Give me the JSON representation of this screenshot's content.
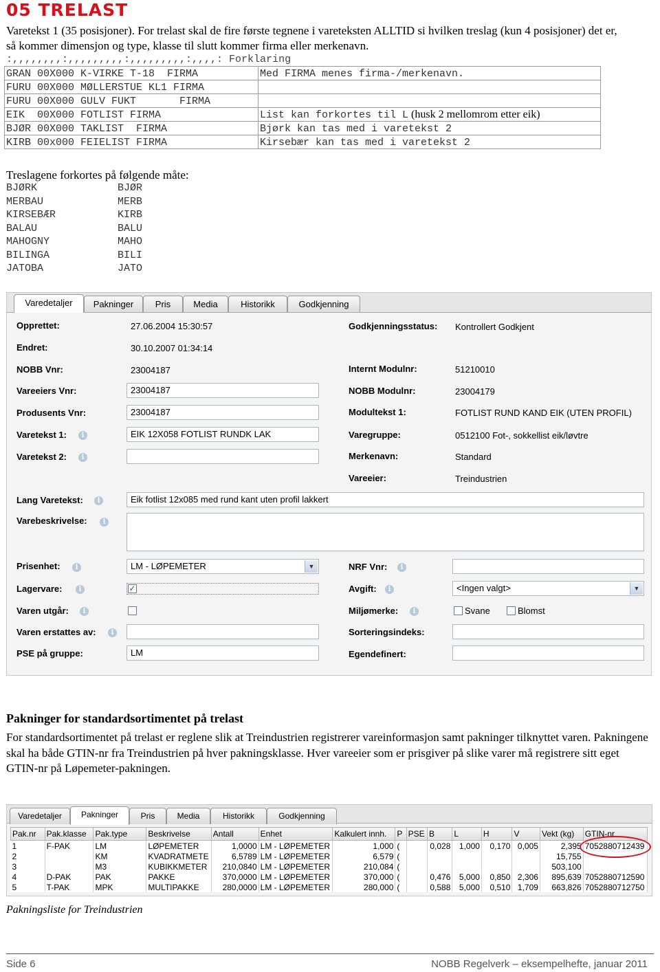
{
  "heading": "05 TRELAST",
  "intro": "Varetekst 1 (35 posisjoner). For trelast skal de fire første tegnene i vareteksten ALLTID si hvilken treslag (kun 4 posisjoner) det er, så kommer dimensjon og type, klasse til slutt kommer firma eller merkenavn.",
  "ruler": ":,,,,,,,,:,,,,,,,,,:,,,,,,,,,:,,,,: Forklaring",
  "code_rows": [
    {
      "code": "GRAN 00X000 K-VIRKE T-18  FIRMA",
      "note": "Med FIRMA menes firma-/merkenavn.",
      "note_extra": ""
    },
    {
      "code": "FURU 00X000 MØLLERSTUE KL1 FIRMA",
      "note": "",
      "note_extra": ""
    },
    {
      "code": "FURU 00X000 GULV FUKT       FIRMA",
      "note": "",
      "note_extra": ""
    },
    {
      "code": "EIK  00X000 FOTLIST FIRMA",
      "note": "List kan forkortes til L",
      "note_extra": " (husk 2 mellomrom etter eik)"
    },
    {
      "code": "BJØR 00X000 TAKLIST  FIRMA",
      "note": "Bjørk kan tas med i varetekst 2",
      "note_extra": ""
    },
    {
      "code": "KIRB 00x000 FEIELIST FIRMA",
      "note": "Kirsebær kan tas med i varetekst 2",
      "note_extra": ""
    }
  ],
  "species_heading": "Treslagene forkortes på følgende måte:",
  "species": [
    {
      "name": "BJØRK",
      "abbr": "BJØR"
    },
    {
      "name": "MERBAU",
      "abbr": "MERB"
    },
    {
      "name": "KIRSEBÆR",
      "abbr": "KIRB"
    },
    {
      "name": "BALAU",
      "abbr": "BALU"
    },
    {
      "name": "MAHOGNY",
      "abbr": "MAHO"
    },
    {
      "name": "BILINGA",
      "abbr": "BILI"
    },
    {
      "name": "JATOBA",
      "abbr": "JATO"
    }
  ],
  "panel1": {
    "tabs": [
      "Varedetaljer",
      "Pakninger",
      "Pris",
      "Media",
      "Historikk",
      "Godkjenning"
    ],
    "left": {
      "opprettet_label": "Opprettet:",
      "opprettet": "27.06.2004 15:30:57",
      "endret_label": "Endret:",
      "endret": "30.10.2007 01:34:14",
      "nobb_label": "NOBB Vnr:",
      "nobb": "23004187",
      "vareeier_label": "Vareeiers Vnr:",
      "vareeier": "23004187",
      "produsent_label": "Produsents Vnr:",
      "produsent": "23004187",
      "vt1_label": "Varetekst 1:",
      "vt1": "EIK  12X058 FOTLIST RUNDK LAK",
      "vt2_label": "Varetekst 2:",
      "vt2": "",
      "lang_label": "Lang Varetekst:",
      "lang": "Eik fotlist 12x085 med rund kant uten profil lakkert",
      "beskr_label": "Varebeskrivelse:",
      "beskr": "",
      "prisenhet_label": "Prisenhet:",
      "prisenhet": "LM - LØPEMETER",
      "lagervare_label": "Lagervare:",
      "utgar_label": "Varen utgår:",
      "erstattes_label": "Varen erstattes av:",
      "erstattes": "",
      "pse_label": "PSE på gruppe:",
      "pse": "LM"
    },
    "right": {
      "godkj_label": "Godkjenningsstatus:",
      "godkj": "Kontrollert Godkjent",
      "intern_label": "Internt Modulnr:",
      "intern": "51210010",
      "nobbmod_label": "NOBB Modulnr:",
      "nobbmod": "23004179",
      "modtekst_label": "Modultekst 1:",
      "modtekst": "FOTLIST RUND KAND EIK (UTEN PROFIL)",
      "varegr_label": "Varegruppe:",
      "varegr": "0512100 Fot-, sokkellist eik/løvtre",
      "merke_label": "Merkenavn:",
      "merke": "Standard",
      "vareeier_label": "Vareeier:",
      "vareeier": "Treindustrien",
      "nrf_label": "NRF Vnr:",
      "nrf": "",
      "avgift_label": "Avgift:",
      "avgift": "<Ingen valgt>",
      "miljo_label": "Miljømerke:",
      "svane": "Svane",
      "blomst": "Blomst",
      "sort_label": "Sorteringsindeks:",
      "sort": "",
      "egen_label": "Egendefinert:",
      "egen": ""
    }
  },
  "pak_heading": "Pakninger for standardsortimentet på trelast",
  "pak_text": "For standardsortimentet på trelast er reglene slik at Treindustrien registrerer vareinformasjon samt pakninger tilknyttet varen. Pakningene skal ha både GTIN-nr fra Treindustrien på hver pakningsklasse. Hver vareeier som er prisgiver på slike varer må registrere sitt eget GTIN-nr på Løpemeter-pakningen.",
  "panel2": {
    "tabs": [
      "Varedetaljer",
      "Pakninger",
      "Pris",
      "Media",
      "Historikk",
      "Godkjenning"
    ],
    "columns": [
      "Pak.nr",
      "Pak.klasse",
      "Pak.type",
      "Beskrivelse",
      "Antall",
      "Enhet",
      "Kalkulert innh.",
      "P",
      "PSE",
      "B",
      "L",
      "H",
      "V",
      "Vekt (kg)",
      "GTIN-nr"
    ],
    "rows": [
      [
        "1",
        "F-PAK",
        "LM",
        "LØPEMETER",
        "1,0000",
        "LM - LØPEMETER",
        "1,000",
        "(",
        "",
        "0,028",
        "1,000",
        "0,170",
        "0,005",
        "2,395",
        "7052880712439"
      ],
      [
        "2",
        "",
        "KM",
        "KVADRATMETE",
        "6,5789",
        "LM - LØPEMETER",
        "6,579",
        "(",
        "",
        "",
        "",
        "",
        "",
        "15,755",
        ""
      ],
      [
        "3",
        "",
        "M3",
        "KUBIKKMETER",
        "210,0840",
        "LM - LØPEMETER",
        "210,084",
        "(",
        "",
        "",
        "",
        "",
        "",
        "503,100",
        ""
      ],
      [
        "4",
        "D-PAK",
        "PAK",
        "PAKKE",
        "370,0000",
        "LM - LØPEMETER",
        "370,000",
        "(",
        "",
        "0,476",
        "5,000",
        "0,850",
        "2,306",
        "895,639",
        "7052880712590"
      ],
      [
        "5",
        "T-PAK",
        "MPK",
        "MULTIPAKKE",
        "280,0000",
        "LM - LØPEMETER",
        "280,000",
        "(",
        "",
        "0,588",
        "5,000",
        "0,510",
        "1,709",
        "663,826",
        "7052880712750"
      ]
    ]
  },
  "caption": "Pakningsliste for Treindustrien",
  "footer_left": "Side 6",
  "footer_right": "NOBB Regelverk – eksempelhefte, januar 2011"
}
